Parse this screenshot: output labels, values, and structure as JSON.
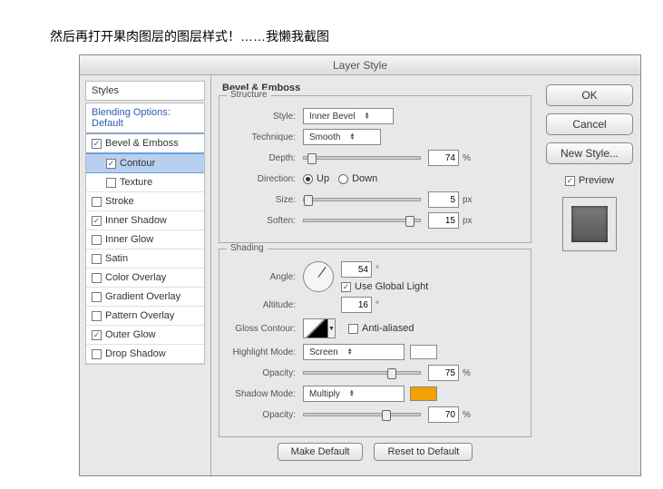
{
  "caption": "然后再打开果肉图层的图层样式！……我懒我截图",
  "dialog": {
    "title": "Layer Style"
  },
  "stylesHeader": "Styles",
  "effects": {
    "blending": "Blending Options: Default",
    "bevel": "Bevel & Emboss",
    "contour": "Contour",
    "texture": "Texture",
    "stroke": "Stroke",
    "innerShadow": "Inner Shadow",
    "innerGlow": "Inner Glow",
    "satin": "Satin",
    "colorOverlay": "Color Overlay",
    "gradientOverlay": "Gradient Overlay",
    "patternOverlay": "Pattern Overlay",
    "outerGlow": "Outer Glow",
    "dropShadow": "Drop Shadow"
  },
  "panel": {
    "title": "Bevel & Emboss",
    "structure": {
      "legend": "Structure",
      "styleLabel": "Style:",
      "styleValue": "Inner Bevel",
      "techniqueLabel": "Technique:",
      "techniqueValue": "Smooth",
      "depthLabel": "Depth:",
      "depthValue": "74",
      "depthUnit": "%",
      "directionLabel": "Direction:",
      "up": "Up",
      "down": "Down",
      "sizeLabel": "Size:",
      "sizeValue": "5",
      "sizeUnit": "px",
      "softenLabel": "Soften:",
      "softenValue": "15",
      "softenUnit": "px"
    },
    "shading": {
      "legend": "Shading",
      "angleLabel": "Angle:",
      "angleValue": "54",
      "angleUnit": "°",
      "globalLight": "Use Global Light",
      "altitudeLabel": "Altitude:",
      "altitudeValue": "16",
      "altitudeUnit": "°",
      "glossLabel": "Gloss Contour:",
      "antiAliased": "Anti-aliased",
      "highlightModeLabel": "Highlight Mode:",
      "highlightModeValue": "Screen",
      "highlightColor": "#ffffff",
      "hOpacityLabel": "Opacity:",
      "hOpacityValue": "75",
      "hOpacityUnit": "%",
      "shadowModeLabel": "Shadow Mode:",
      "shadowModeValue": "Multiply",
      "shadowColor": "#f2a100",
      "sOpacityLabel": "Opacity:",
      "sOpacityValue": "70",
      "sOpacityUnit": "%"
    },
    "makeDefault": "Make Default",
    "resetDefault": "Reset to Default"
  },
  "right": {
    "ok": "OK",
    "cancel": "Cancel",
    "newStyle": "New Style...",
    "preview": "Preview"
  }
}
